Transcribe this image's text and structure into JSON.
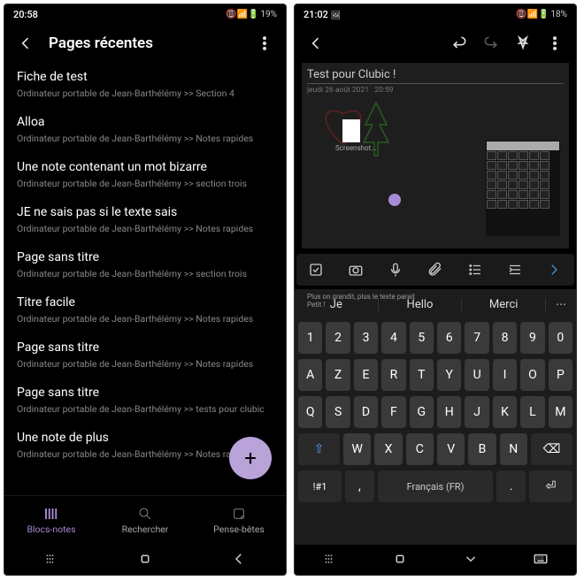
{
  "left": {
    "status": {
      "time": "20:58",
      "battery": "19%",
      "icons": "📵📶🔋"
    },
    "appbar": {
      "title": "Pages récentes"
    },
    "pages": [
      {
        "title": "Fiche de test",
        "path": "Ordinateur portable de Jean-Barthélémy >> Section 4"
      },
      {
        "title": "Alloa",
        "path": "Ordinateur portable de Jean-Barthélémy >> Notes rapides"
      },
      {
        "title": "Une note contenant un mot bizarre",
        "path": "Ordinateur portable de Jean-Barthélémy >> section trois"
      },
      {
        "title": "JE ne sais pas si le texte sais",
        "path": "Ordinateur portable de Jean-Barthélémy >> Notes rapides"
      },
      {
        "title": "Page sans titre",
        "path": "Ordinateur portable de Jean-Barthélémy >> section trois"
      },
      {
        "title": "Titre facile",
        "path": "Ordinateur portable de Jean-Barthélémy >> Notes rapides"
      },
      {
        "title": "Page sans titre",
        "path": "Ordinateur portable de Jean-Barthélémy >> Notes rapides"
      },
      {
        "title": "Page sans titre",
        "path": "Ordinateur portable de Jean-Barthélémy >> tests pour clubic"
      },
      {
        "title": "Une note de plus",
        "path": "Ordinateur portable de Jean-Barthélémy >> Notes rap..."
      }
    ],
    "tabs": [
      {
        "label": "Blocs-notes",
        "active": true
      },
      {
        "label": "Rechercher",
        "active": false
      },
      {
        "label": "Pense-bêtes",
        "active": false
      }
    ],
    "fab": "+"
  },
  "right": {
    "status": {
      "time": "21:02",
      "battery": "18%",
      "icons": "🖼 📵📶🔋"
    },
    "note": {
      "title": "Test pour Clubic !",
      "meta_date": "jeudi 26 août 2021",
      "meta_time": "20:59",
      "doc_label": "Screenshot...",
      "caption": "Plus on grandit, plus le texte parait\nPetit !"
    },
    "suggestions": [
      "Je",
      "Hello",
      "Merci"
    ],
    "keyboard": {
      "row1": [
        "1",
        "2",
        "3",
        "4",
        "5",
        "6",
        "7",
        "8",
        "9",
        "0"
      ],
      "row2": [
        "A",
        "Z",
        "E",
        "R",
        "T",
        "Y",
        "U",
        "I",
        "O",
        "P"
      ],
      "row3": [
        "Q",
        "S",
        "D",
        "F",
        "G",
        "H",
        "J",
        "K",
        "L",
        "M"
      ],
      "row4_mid": [
        "W",
        "X",
        "C",
        "V",
        "B",
        "N"
      ],
      "shift": "⇧",
      "backspace": "⌫",
      "symbols": "!#1",
      "comma": ",",
      "space": "Français (FR)",
      "period": ".",
      "enter": "⏎"
    }
  }
}
